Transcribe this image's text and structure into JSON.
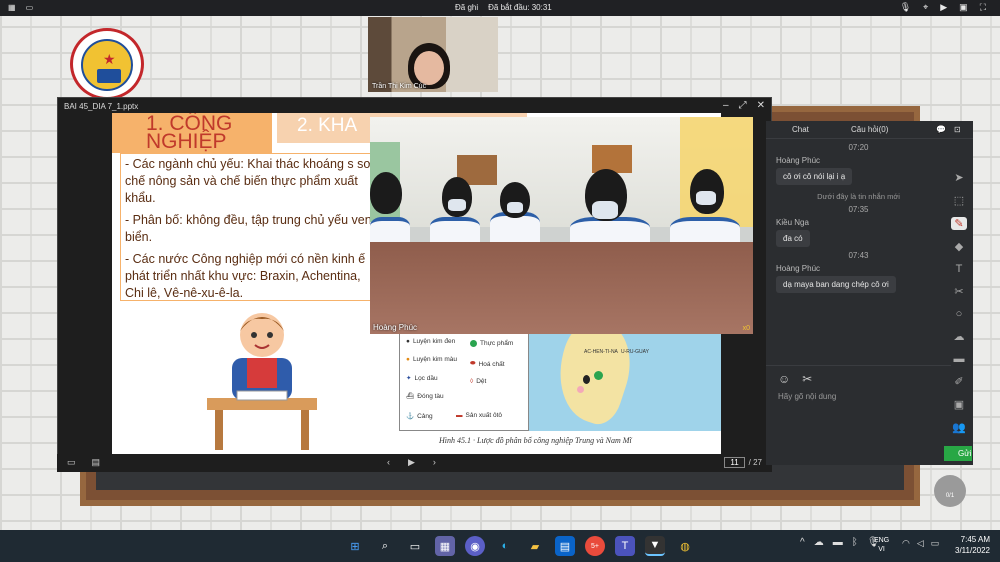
{
  "topbar": {
    "recording": "Đã ghi",
    "elapsed": "Đã bắt đầu: 30:31",
    "mic_icon": "mic-icon",
    "camera_icon": "camera-icon"
  },
  "participant": {
    "name": "Trần Thị Kim Cúc"
  },
  "ppt": {
    "filename": "BAI 45_DIA 7_1.pptx",
    "current_page": "11",
    "total_pages": "/ 27"
  },
  "slide": {
    "heading1": "1. CÔNG NGHIỆP",
    "heading2": "2. KHA",
    "bullets": [
      "- Các ngành chủ yếu: Khai thác khoáng s sơ chế nông sản và chế biến thực phẩm xuất khẩu.",
      "- Phân bố: không đều, tập trung chủ yếu ven biển.",
      "- Các nước Công nghiệp mới có nền kinh ế phát triển nhất khu vực: Braxin, Achentina, Chi lê, Vê-nê-xu-ê-la."
    ],
    "legend": [
      "Luyện kim đen",
      "Thực phẩm",
      "Luyện kim màu",
      "Hoá chất",
      "Lọc dầu",
      "Dệt",
      "Đóng tàu",
      "Cảng",
      "Sản xuất ôtô"
    ],
    "caption": "Hình 45.1 · Lược đồ phân bố công nghiệp Trung và Nam Mĩ",
    "map_labels": [
      "AC-HEN-TI-NA",
      "U-RU-GUAY"
    ]
  },
  "video": {
    "name": "Hoàng Phúc",
    "badge": "x0"
  },
  "chat": {
    "tab_chat": "Chat",
    "tab_questions": "Câu hỏi(0)",
    "messages": [
      {
        "time": "07:20",
        "sender": "Hoàng Phúc",
        "text": "cô ơi cô nói lại i ạ"
      },
      {
        "time": "07:35",
        "sender": "Kiều Nga",
        "text": "đa có"
      },
      {
        "time": "07:43",
        "sender": "Hoàng Phúc",
        "text": "dạ maya ban dang chép cô ơi"
      }
    ],
    "unread_divider": "Dưới đây là tin nhắn mới",
    "input_placeholder": "Hãy gõ nội dung",
    "send_label": "Gửi"
  },
  "float_button": "0/1",
  "taskbar": {
    "lang_top": "ENG",
    "lang_bottom": "VI",
    "time": "7:45 AM",
    "date": "3/11/2022",
    "badge": "5+"
  }
}
